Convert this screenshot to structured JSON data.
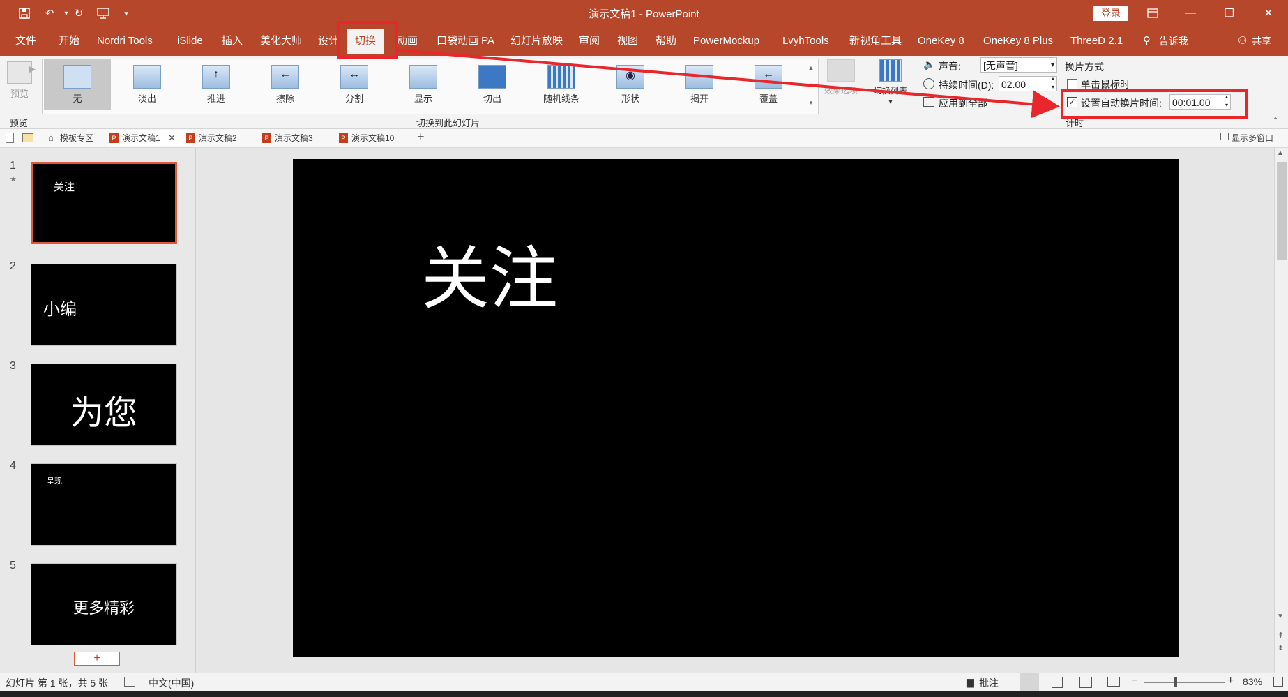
{
  "title_bar": {
    "title": "演示文稿1 - PowerPoint",
    "login": "登录"
  },
  "menu_tabs": [
    "文件",
    "开始",
    "Nordri Tools",
    "iSlide",
    "插入",
    "美化大师",
    "设计",
    "切换",
    "动画",
    "口袋动画 PA",
    "幻灯片放映",
    "审阅",
    "视图",
    "帮助",
    "PowerMockup",
    "LvyhTools",
    "新视角工具",
    "OneKey 8",
    "OneKey 8 Plus",
    "ThreeD 2.1"
  ],
  "tell_me": "告诉我",
  "share": "共享",
  "ribbon": {
    "preview_label": "预览",
    "preview_group": "预览",
    "transitions": [
      "无",
      "淡出",
      "推进",
      "擦除",
      "分割",
      "显示",
      "切出",
      "随机线条",
      "形状",
      "揭开",
      "覆盖"
    ],
    "transitions_group": "切换到此幻灯片",
    "effect_options": "效果选项",
    "transition_list": "切换列表",
    "sound_label": "声音:",
    "sound_value": "[无声音]",
    "duration_label": "持续时间(D):",
    "duration_value": "02.00",
    "apply_all": "应用到全部",
    "advance_title": "换片方式",
    "on_click": "单击鼠标时",
    "auto_after": "设置自动换片时间:",
    "auto_value": "00:01.00",
    "timing_group": "计时"
  },
  "doc_tabs": [
    "模板专区",
    "演示文稿1",
    "演示文稿2",
    "演示文稿3",
    "演示文稿10"
  ],
  "show_multi": "显示多窗口",
  "slides": [
    {
      "num": "1",
      "text": "关注"
    },
    {
      "num": "2",
      "text": "小编"
    },
    {
      "num": "3",
      "text": "为您"
    },
    {
      "num": "4",
      "text": "呈现"
    },
    {
      "num": "5",
      "text": "更多精彩"
    }
  ],
  "current_slide_text": "关注",
  "add_slide": "+",
  "status": {
    "slide_info": "幻灯片 第 1 张，共 5 张",
    "language": "中文(中国)",
    "comments": "批注",
    "zoom": "83%"
  },
  "colors": {
    "accent": "#b7472a",
    "annotation": "#e8262b"
  }
}
